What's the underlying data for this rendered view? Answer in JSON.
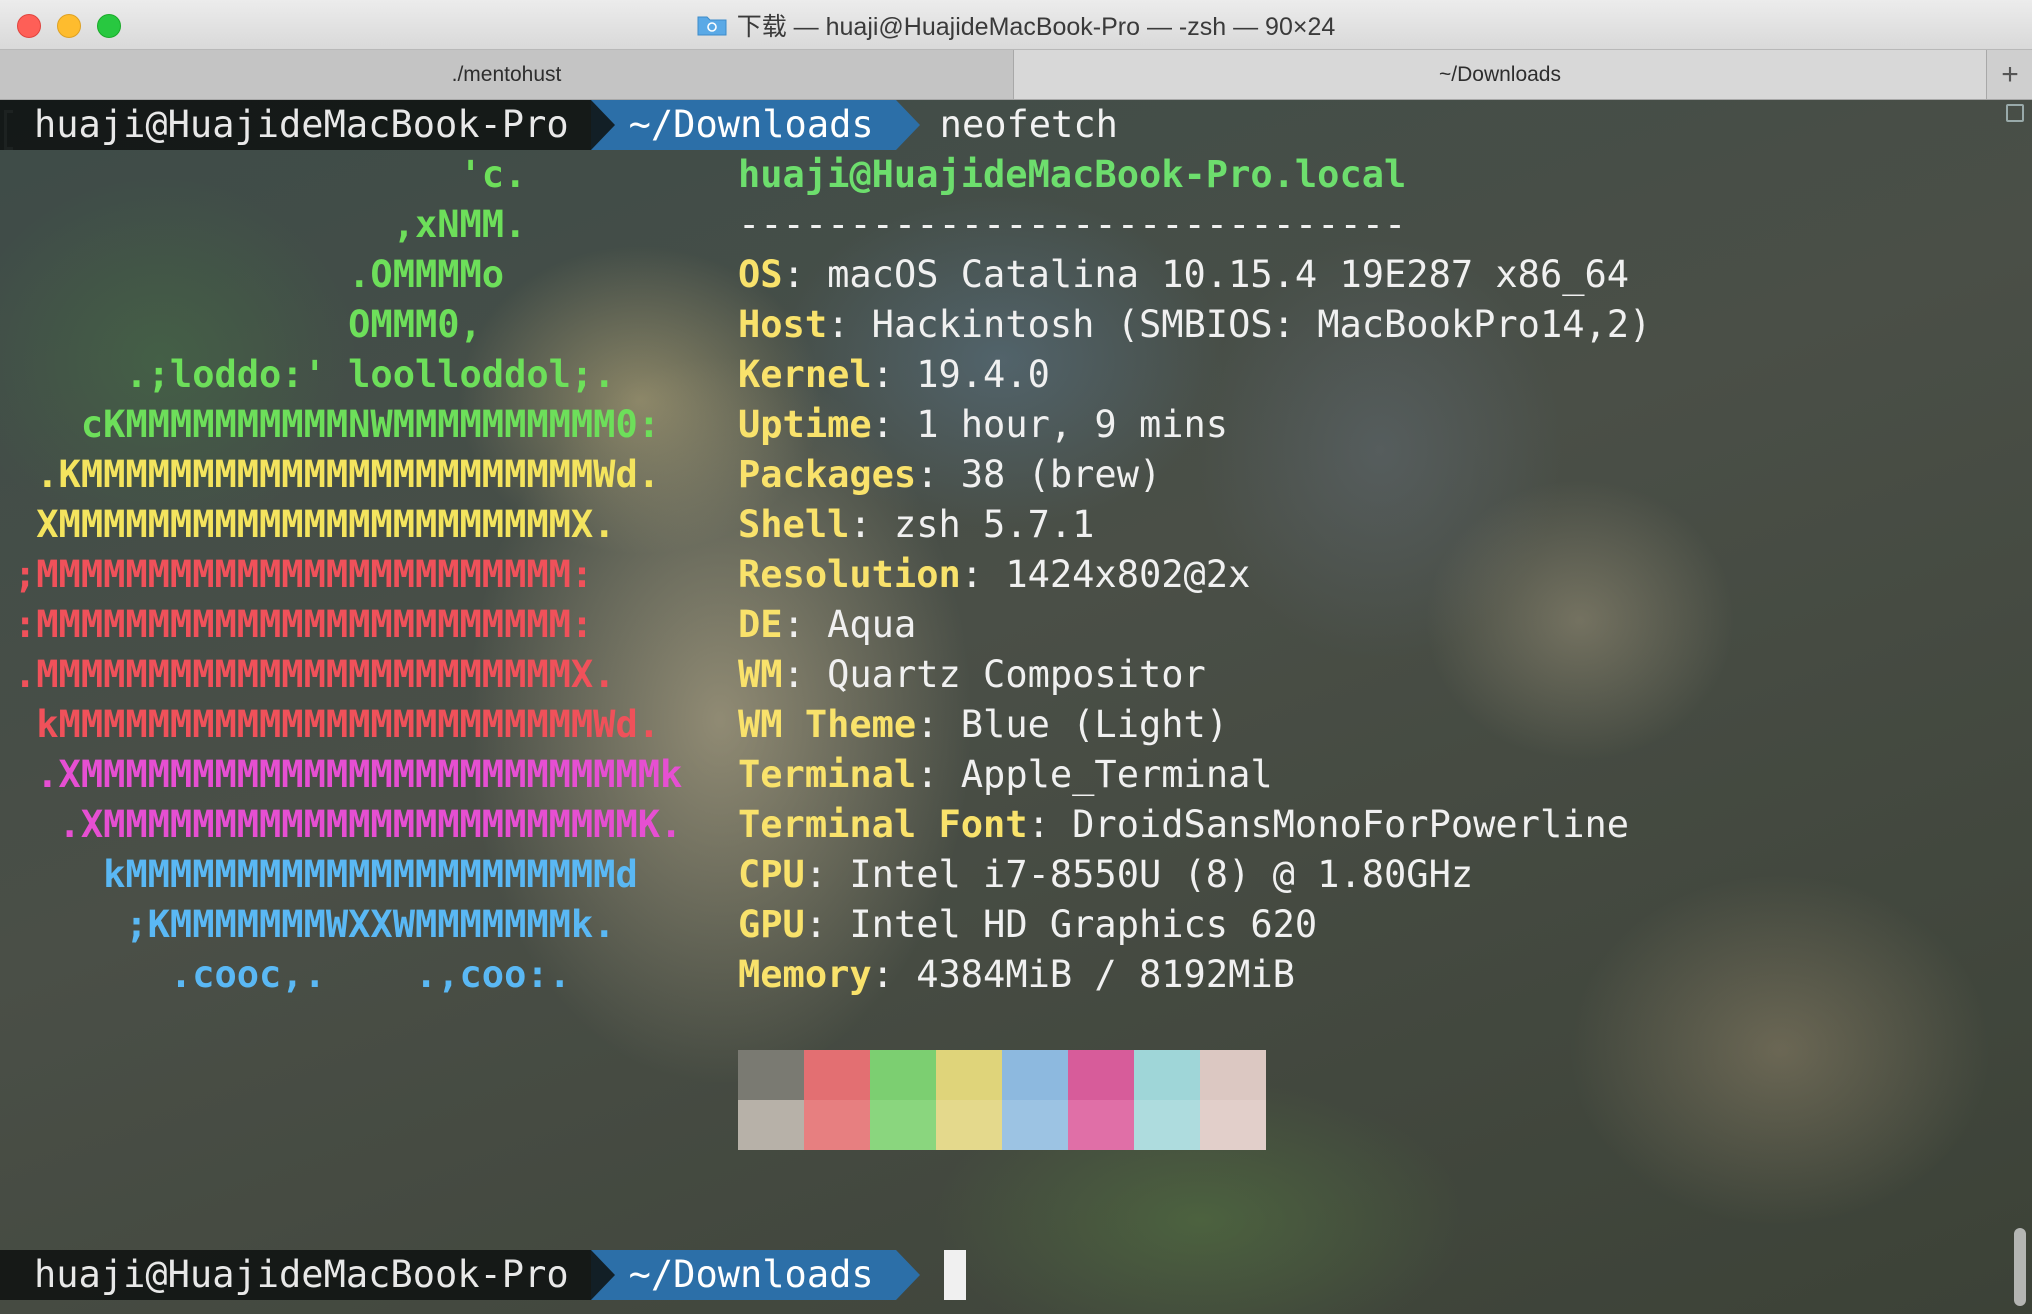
{
  "window": {
    "title": "下载 — huaji@HuajideMacBook-Pro — -zsh — 90×24"
  },
  "tabs": [
    {
      "label": "./mentohust"
    },
    {
      "label": "~/Downloads"
    }
  ],
  "tab_add_label": "+",
  "prompt": {
    "user": "huaji@HuajideMacBook-Pro",
    "dir": "~/Downloads",
    "command": "neofetch"
  },
  "ascii_logo": [
    {
      "text": "                    'c.",
      "color": "#6ddf5a"
    },
    {
      "text": "                 ,xNMM.",
      "color": "#6ddf5a"
    },
    {
      "text": "               .OMMMMo",
      "color": "#6ddf5a"
    },
    {
      "text": "               OMMM0,",
      "color": "#6ddf5a"
    },
    {
      "text": "     .;loddo:' loolloddol;.",
      "color": "#6ddf5a"
    },
    {
      "text": "   cKMMMMMMMMMMNWMMMMMMMMMM0:",
      "color": "#6ddf5a"
    },
    {
      "text": " .KMMMMMMMMMMMMMMMMMMMMMMMWd.",
      "color": "#f4e45e"
    },
    {
      "text": " XMMMMMMMMMMMMMMMMMMMMMMMX.",
      "color": "#f4e45e"
    },
    {
      "text": ";MMMMMMMMMMMMMMMMMMMMMMMM:",
      "color": "#f0515a"
    },
    {
      "text": ":MMMMMMMMMMMMMMMMMMMMMMMM:",
      "color": "#f0515a"
    },
    {
      "text": ".MMMMMMMMMMMMMMMMMMMMMMMMX.",
      "color": "#f0515a"
    },
    {
      "text": " kMMMMMMMMMMMMMMMMMMMMMMMMWd.",
      "color": "#f0515a"
    },
    {
      "text": " .XMMMMMMMMMMMMMMMMMMMMMMMMMMk",
      "color": "#e64fd2"
    },
    {
      "text": "  .XMMMMMMMMMMMMMMMMMMMMMMMMK.",
      "color": "#e64fd2"
    },
    {
      "text": "    kMMMMMMMMMMMMMMMMMMMMMMd",
      "color": "#5ab8f4"
    },
    {
      "text": "     ;KMMMMMMMWXXWMMMMMMMk.",
      "color": "#5ab8f4"
    },
    {
      "text": "       .cooc,.    .,coo:.",
      "color": "#5ab8f4"
    }
  ],
  "info": {
    "host_title": "huaji@HuajideMacBook-Pro.local",
    "divider": "------------------------------",
    "rows": [
      {
        "key": "OS",
        "value": "macOS Catalina 10.15.4 19E287 x86_64"
      },
      {
        "key": "Host",
        "value": "Hackintosh (SMBIOS: MacBookPro14,2)"
      },
      {
        "key": "Kernel",
        "value": "19.4.0"
      },
      {
        "key": "Uptime",
        "value": "1 hour, 9 mins"
      },
      {
        "key": "Packages",
        "value": "38 (brew)"
      },
      {
        "key": "Shell",
        "value": "zsh 5.7.1"
      },
      {
        "key": "Resolution",
        "value": "1424x802@2x"
      },
      {
        "key": "DE",
        "value": "Aqua"
      },
      {
        "key": "WM",
        "value": "Quartz Compositor"
      },
      {
        "key": "WM Theme",
        "value": "Blue (Light)"
      },
      {
        "key": "Terminal",
        "value": "Apple_Terminal"
      },
      {
        "key": "Terminal Font",
        "value": "DroidSansMonoForPowerline"
      },
      {
        "key": "CPU",
        "value": "Intel i7-8550U (8) @ 1.80GHz"
      },
      {
        "key": "GPU",
        "value": "Intel HD Graphics 620"
      },
      {
        "key": "Memory",
        "value": "4384MiB / 8192MiB"
      }
    ]
  },
  "palette": [
    [
      "#7a7a72",
      "#b7b1a8"
    ],
    [
      "#e36f72",
      "#e77f80"
    ],
    [
      "#7ccf71",
      "#8ad67e"
    ],
    [
      "#dfd47a",
      "#e4d98c"
    ],
    [
      "#8db9df",
      "#9cc3e3"
    ],
    [
      "#d75c9a",
      "#e06fa7"
    ],
    [
      "#9fd6d8",
      "#aedcde"
    ],
    [
      "#dcc8c2",
      "#e2cfca"
    ]
  ]
}
